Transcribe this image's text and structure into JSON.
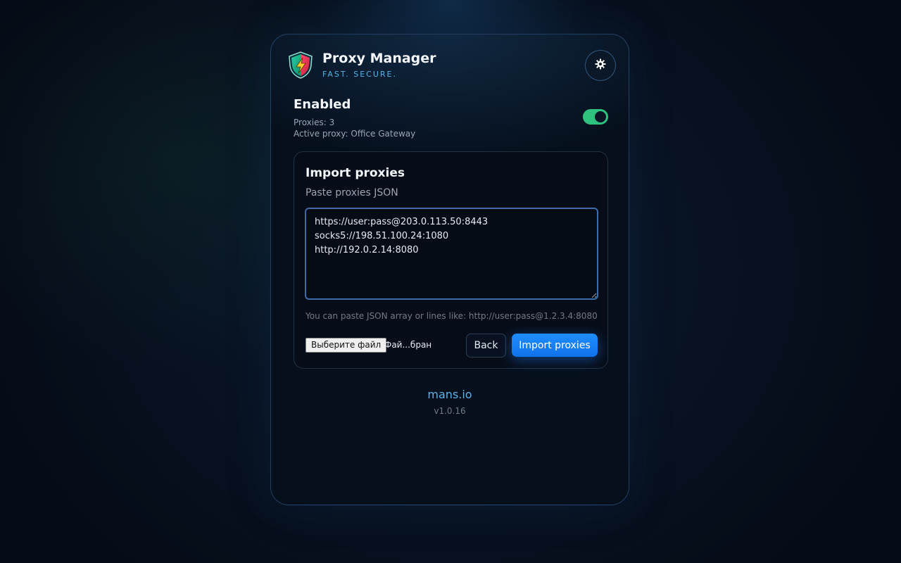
{
  "header": {
    "title": "Proxy Manager",
    "tagline": "FAST. SECURE.",
    "logo_icon": "shield-lightning-icon",
    "settings_icon": "gear-icon"
  },
  "status": {
    "title": "Enabled",
    "proxies_line": "Proxies: 3",
    "active_line": "Active proxy: Office Gateway",
    "toggle_on": true
  },
  "import": {
    "title": "Import proxies",
    "subtitle": "Paste proxies JSON",
    "textarea_value": "https://user:pass@203.0.113.50:8443\nsocks5://198.51.100.24:1080\nhttp://192.0.2.14:8080",
    "hint": "You can paste JSON array or lines like: http://user:pass@1.2.3.4:8080",
    "file_button_label": "Выберите файл",
    "file_status": "Фай...бран",
    "back_label": "Back",
    "import_label": "Import proxies"
  },
  "footer": {
    "link": "mans.io",
    "version": "v1.0.16"
  },
  "colors": {
    "accent": "#1f8eff",
    "toggle": "#2ec27e",
    "link": "#5cb2e8",
    "tagline": "#4fb4e8"
  }
}
